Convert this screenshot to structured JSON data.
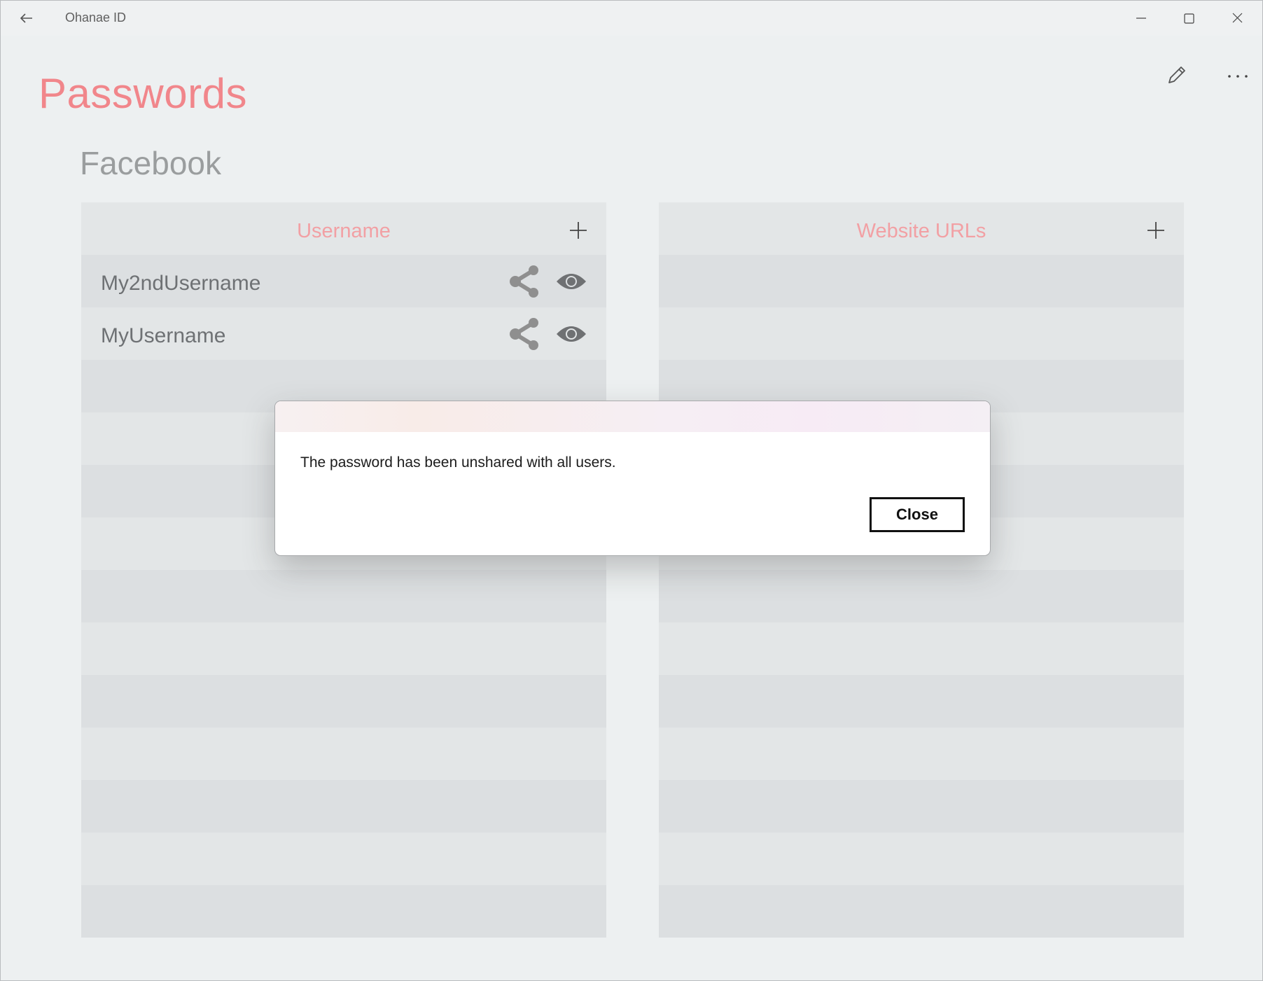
{
  "window": {
    "title": "Ohanae ID",
    "back_icon": "arrow-left-icon",
    "controls": [
      "minimize-icon",
      "maximize-icon",
      "close-icon"
    ]
  },
  "page": {
    "title": "Passwords",
    "section_title": "Facebook",
    "toolbar_icons": [
      "pencil-icon",
      "more-icon"
    ]
  },
  "username_panel": {
    "header": "Username",
    "add_icon": "plus-icon",
    "items": [
      {
        "label": "My2ndUsername"
      },
      {
        "label": "MyUsername"
      }
    ]
  },
  "urls_panel": {
    "header": "Website URLs",
    "add_icon": "plus-icon",
    "items": []
  },
  "dialog": {
    "message": "The password has been unshared with all users.",
    "close_label": "Close"
  },
  "colors": {
    "accent": "#f1868b",
    "header_text": "#f2a0a4",
    "icon_gray": "#8a8a8a"
  }
}
